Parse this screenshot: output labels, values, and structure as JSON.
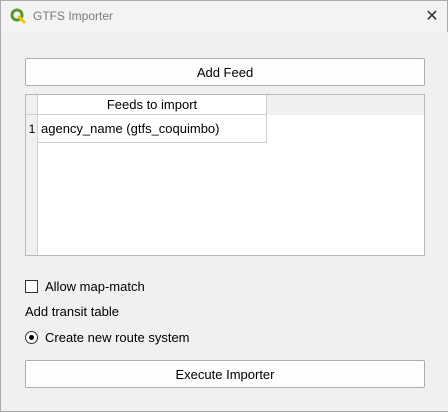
{
  "window": {
    "title": "GTFS Importer",
    "app_icon": "qgis-icon",
    "close_icon": "close-icon"
  },
  "buttons": {
    "add_feed": "Add Feed",
    "execute": "Execute Importer"
  },
  "table": {
    "header": "Feeds to import",
    "rows": [
      {
        "num": "1",
        "value": "agency_name (gtfs_coquimbo)"
      }
    ]
  },
  "options": {
    "allow_map_match": {
      "label": "Allow map-match",
      "checked": false
    },
    "transit_table_label": "Add transit table",
    "create_route_system": {
      "label": "Create new route system",
      "selected": true
    }
  },
  "colors": {
    "qgis_green": "#589632",
    "qgis_yellow": "#f0c419"
  }
}
